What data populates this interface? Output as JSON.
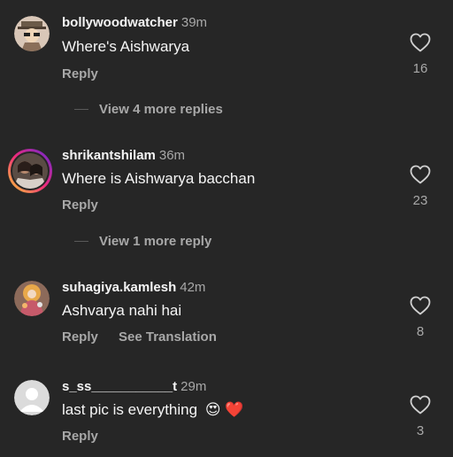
{
  "comments": [
    {
      "username": "bollywoodwatcher",
      "time": "39m",
      "text": "Where's Aishwarya",
      "reply": "Reply",
      "likes": "16",
      "more_replies": "View 4 more replies"
    },
    {
      "username": "shrikantshilam",
      "time": "36m",
      "text": "Where is Aishwarya bacchan",
      "reply": "Reply",
      "likes": "23",
      "more_replies": "View 1 more reply"
    },
    {
      "username": "suhagiya.kamlesh",
      "time": "42m",
      "text": "Ashvarya nahi hai",
      "reply": "Reply",
      "see_translation": "See Translation",
      "likes": "8"
    },
    {
      "username": "s_ss___________t",
      "time": "29m",
      "text": "last pic is everything",
      "emojis": "😍 ❤️",
      "reply": "Reply",
      "likes": "3"
    }
  ],
  "colors": {
    "background": "#262626",
    "primary_text": "#f5f5f5",
    "secondary_text": "#a8a8a8",
    "story_ring": "#d62976"
  },
  "icons": {
    "like": "heart-outline-icon"
  }
}
